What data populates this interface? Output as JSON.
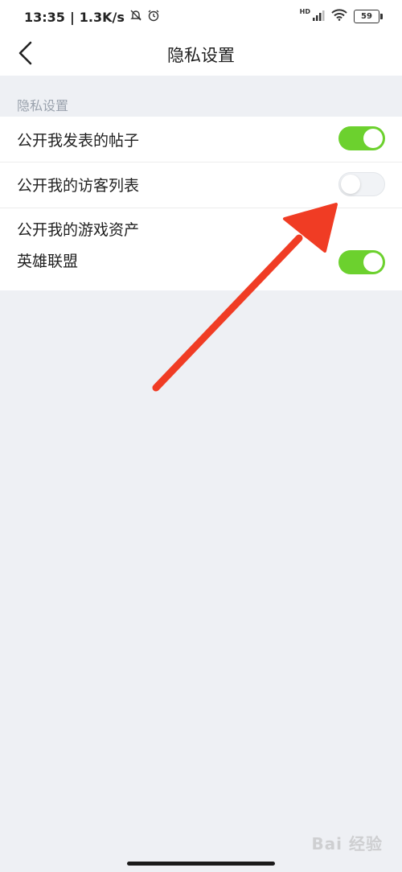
{
  "status_bar": {
    "time": "13:35",
    "separator": "|",
    "net_speed": "1.3K/s",
    "mute_icon": "bell-off-icon",
    "alarm_icon": "alarm-clock-icon",
    "hd_label": "HD",
    "signal_icon": "signal-icon",
    "wifi_icon": "wifi-icon",
    "battery": "59"
  },
  "header": {
    "back_icon": "chevron-left-icon",
    "title": "隐私设置"
  },
  "section": {
    "label": "隐私设置"
  },
  "settings": {
    "items": [
      {
        "label": "公开我发表的帖子",
        "sublabel": "",
        "enabled": true
      },
      {
        "label": "公开我的访客列表",
        "sublabel": "",
        "enabled": false
      },
      {
        "label": "公开我的游戏资产",
        "sublabel": "英雄联盟",
        "enabled": true
      }
    ]
  },
  "colors": {
    "toggle_on": "#6cd12e",
    "toggle_off": "#f1f3f6",
    "arrow": "#f03c24",
    "background": "#eef0f4"
  },
  "watermark": {
    "text": "Bai 经验"
  }
}
